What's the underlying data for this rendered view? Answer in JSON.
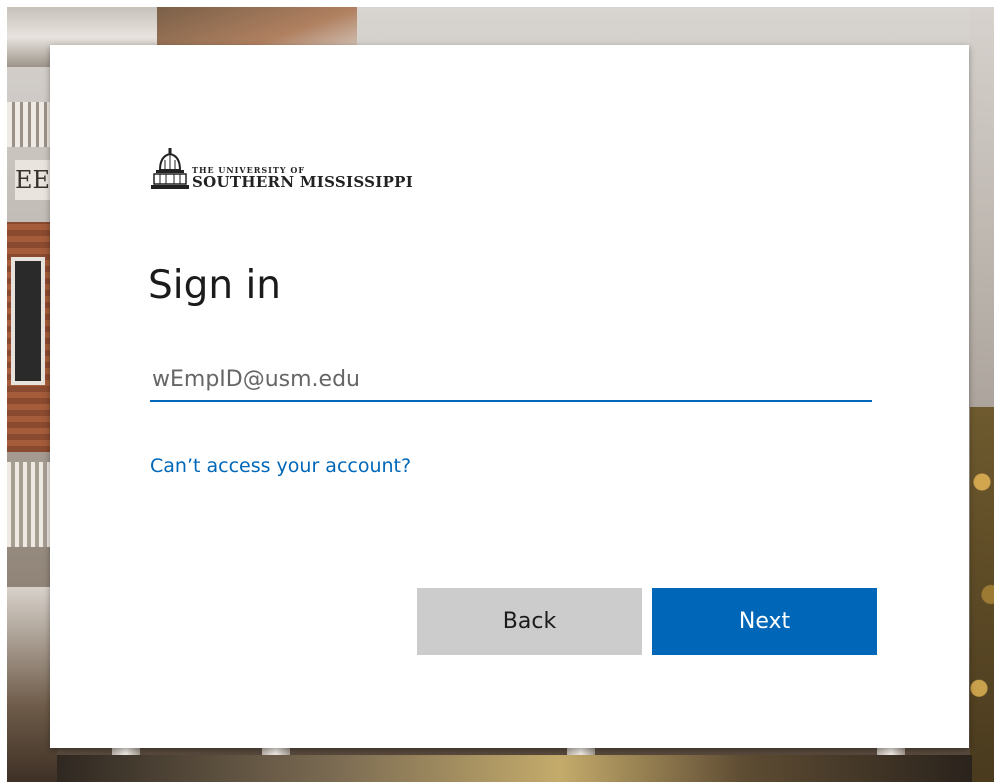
{
  "logo": {
    "line1": "THE UNIVERSITY OF",
    "line2": "SOUTHERN MISSISSIPPI",
    "seal_icon": "dome-seal-icon",
    "background_text": "EE"
  },
  "signin": {
    "title": "Sign in",
    "email_placeholder": "wEmpID@usm.edu",
    "email_value": "",
    "cant_access_link": "Can’t access your account?"
  },
  "buttons": {
    "back_label": "Back",
    "next_label": "Next"
  },
  "colors": {
    "accent": "#0067b8",
    "back_button": "#cccccc",
    "title_text": "#1b1b1b"
  }
}
